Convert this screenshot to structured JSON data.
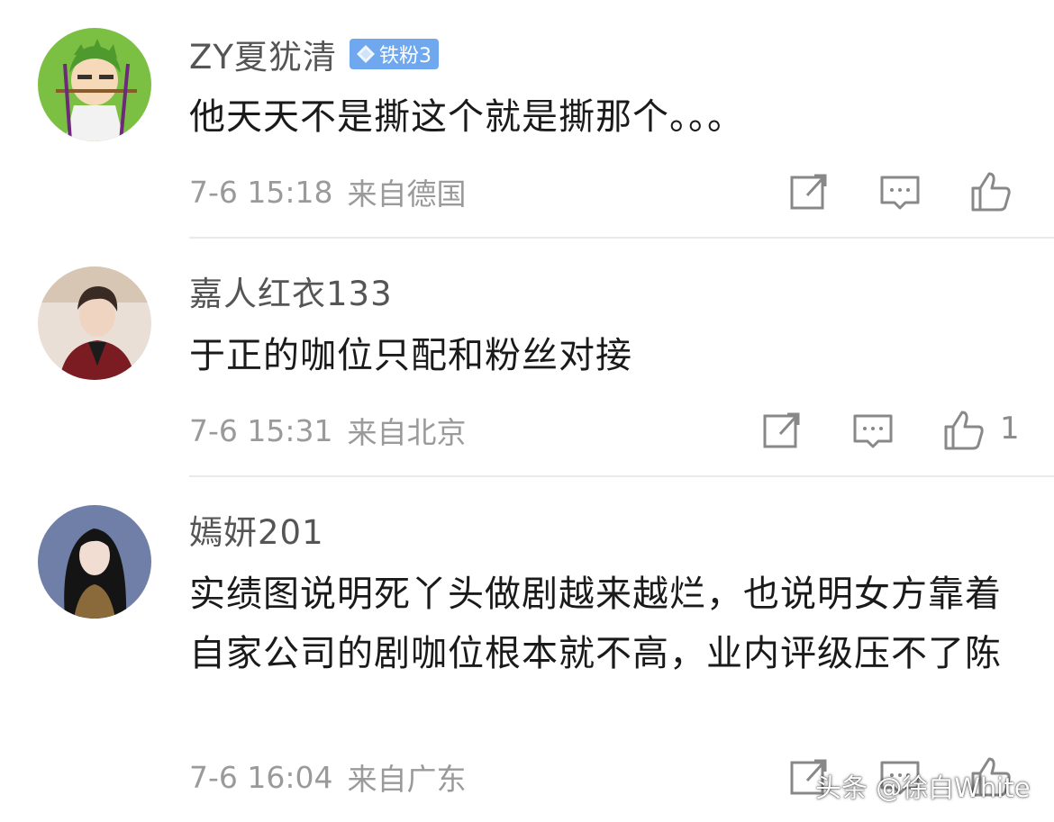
{
  "comments": [
    {
      "username": "ZY夏犹清",
      "badge": "铁粉3",
      "text": "他天天不是撕这个就是撕那个。。。",
      "time": "7-6 15:18",
      "location": "来自德国",
      "like_count": "",
      "avatar_icon": "anime-character-avatar"
    },
    {
      "username": "嘉人红衣133",
      "text": "于正的咖位只配和粉丝对接",
      "time": "7-6 15:31",
      "location": "来自北京",
      "like_count": "1",
      "avatar_icon": "man-in-red-jacket-avatar"
    },
    {
      "username": "嫣妍201",
      "text": "实绩图说明死丫头做剧越来越烂，也说明女方靠着自家公司的剧咖位根本就不高，业内评级压不了陈",
      "time": "7-6 16:04",
      "location": "来自广东",
      "like_count": "",
      "avatar_icon": "woman-long-hair-avatar"
    }
  ],
  "watermark": "头条 @徐白White",
  "colors": {
    "badge_bg": "#6fa8ef",
    "meta_text": "#9a9a9a",
    "icon_stroke": "#888888"
  }
}
